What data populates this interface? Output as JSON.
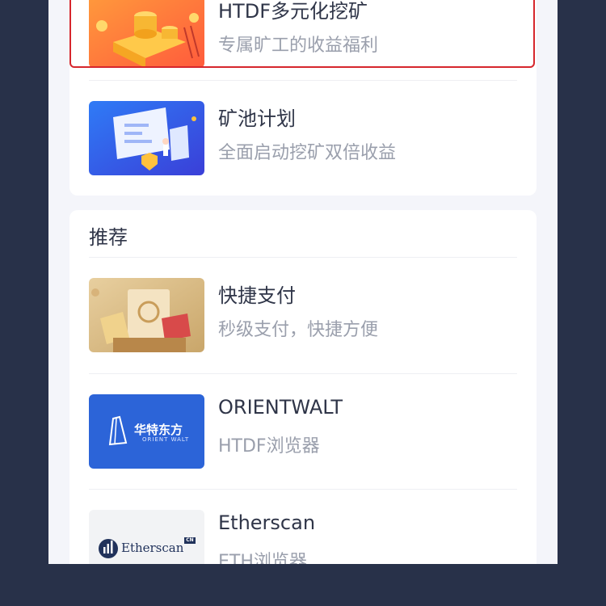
{
  "colors": {
    "background": "#283149",
    "page": "#f4f5fa",
    "card": "#ffffff",
    "title_text": "#2f3548",
    "sub_text": "#9a9fac",
    "highlight_border": "#d6262d"
  },
  "mining": {
    "items": [
      {
        "title": "HTDF多元化挖矿",
        "subtitle": "专属旷工的收益福利",
        "icon": "gold-coins-illustration"
      },
      {
        "title": "矿池计划",
        "subtitle": "全面启动挖矿双倍收益",
        "icon": "mining-pool-illustration"
      }
    ]
  },
  "recommend": {
    "section_title": "推荐",
    "items": [
      {
        "title": "快捷支付",
        "subtitle": "秒级支付，快捷方便",
        "icon": "payment-cards-illustration"
      },
      {
        "title": "ORIENTWALT",
        "subtitle": "HTDF浏览器",
        "icon": "orientwalt-logo",
        "logo_text": "华特东方",
        "logo_sub": "ORIENT WALT"
      },
      {
        "title": "Etherscan",
        "subtitle": "ETH浏览器",
        "icon": "etherscan-logo",
        "logo_text": "Etherscan",
        "logo_badge": "CN"
      }
    ]
  }
}
